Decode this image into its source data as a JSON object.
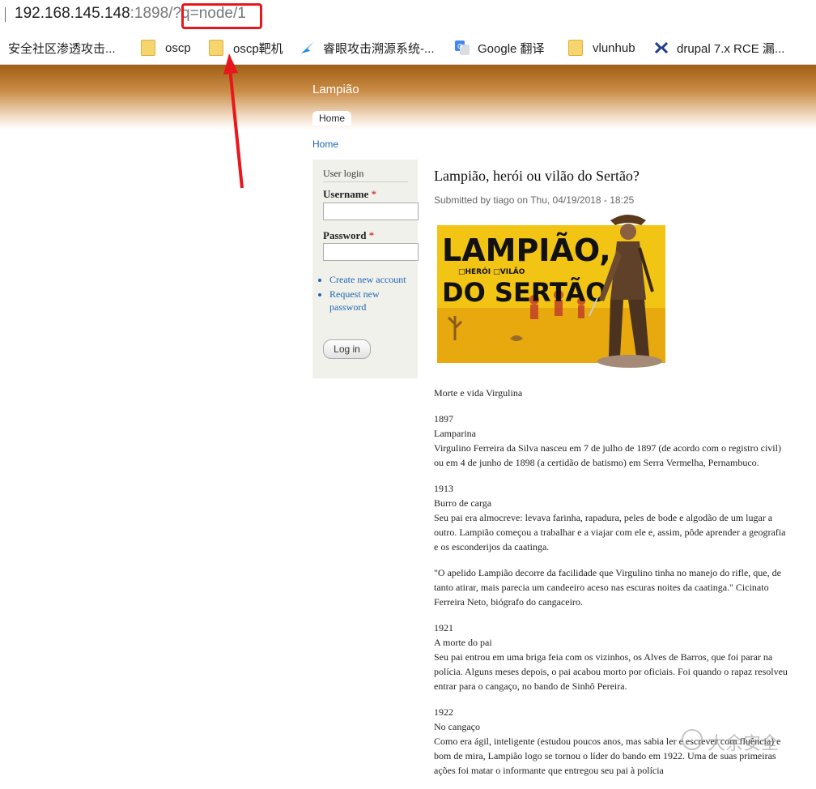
{
  "browser": {
    "url_main": "192.168.145.148",
    "url_rest": ":1898/?q",
    "url_highlight": "=node/1"
  },
  "bookmarks": [
    {
      "label": "安全社区渗透攻击...",
      "icon": "none"
    },
    {
      "label": "oscp",
      "icon": "folder-icon"
    },
    {
      "label": "oscp靶机",
      "icon": "folder-icon"
    },
    {
      "label": "睿眼攻击溯源系统-...",
      "icon": "bird-icon"
    },
    {
      "label": "Google 翻译",
      "icon": "translate-icon"
    },
    {
      "label": "vlunhub",
      "icon": "folder-icon"
    },
    {
      "label": "drupal 7.x RCE 漏...",
      "icon": "x-icon"
    }
  ],
  "site": {
    "name": "Lampião",
    "tab_home": "Home",
    "breadcrumb": "Home"
  },
  "login": {
    "title": "User login",
    "username_label": "Username",
    "password_label": "Password",
    "required_mark": "*",
    "create_account": "Create new account",
    "request_password": "Request new password",
    "login_button": "Log in"
  },
  "node": {
    "title": "Lampião, herói ou vilão do Sertão?",
    "submitted": "Submitted by tiago on Thu, 04/19/2018 - 18:25",
    "image_text_line1": "LAMPIÃO,",
    "image_text_line2": "□HERÓI □VILÃO",
    "image_text_line3": "DO SERTÃO",
    "intro": "Morte e vida Virgulina",
    "sections": [
      {
        "year": "1897",
        "heading": "Lamparina",
        "text": "Virgulino Ferreira da Silva nasceu em 7 de julho de 1897 (de acordo com o registro civil) ou em 4 de junho de 1898 (a certidão de batismo) em Serra Vermelha, Pernambuco."
      },
      {
        "year": "1913",
        "heading": "Burro de carga",
        "text": "Seu pai era almocreve: levava farinha, rapadura, peles de bode e algodão de um lugar a outro. Lampião começou a trabalhar e a viajar com ele e, assim, pôde aprender a geografia e os esconderijos da caatinga."
      },
      {
        "year": "",
        "heading": "",
        "text": "\"O apelido Lampião decorre da facilidade que Virgulino tinha no manejo do rifle, que, de tanto atirar, mais parecia um candeeiro aceso nas escuras noites da caatinga.\" Cicinato Ferreira Neto, biógrafo do cangaceiro."
      },
      {
        "year": "1921",
        "heading": "A morte do pai",
        "text": "Seu pai entrou em uma briga feia com os vizinhos, os Alves de Barros, que foi parar na polícia. Alguns meses depois, o pai acabou morto por oficiais. Foi quando o rapaz resolveu entrar para o cangaço, no bando de Sinhô Pereira."
      },
      {
        "year": "1922",
        "heading": "No cangaço",
        "text": "Como era ágil, inteligente (estudou poucos anos, mas sabia ler e escrever com fluência) e bom de mira, Lampião logo se tornou o líder do bando em 1922. Uma de suas primeiras ações foi matar o informante que entregou seu pai à polícia"
      }
    ]
  },
  "watermark": "大余安全",
  "colors": {
    "highlight": "#e8171c",
    "link": "#1f66b0",
    "header": "#a15f16"
  }
}
